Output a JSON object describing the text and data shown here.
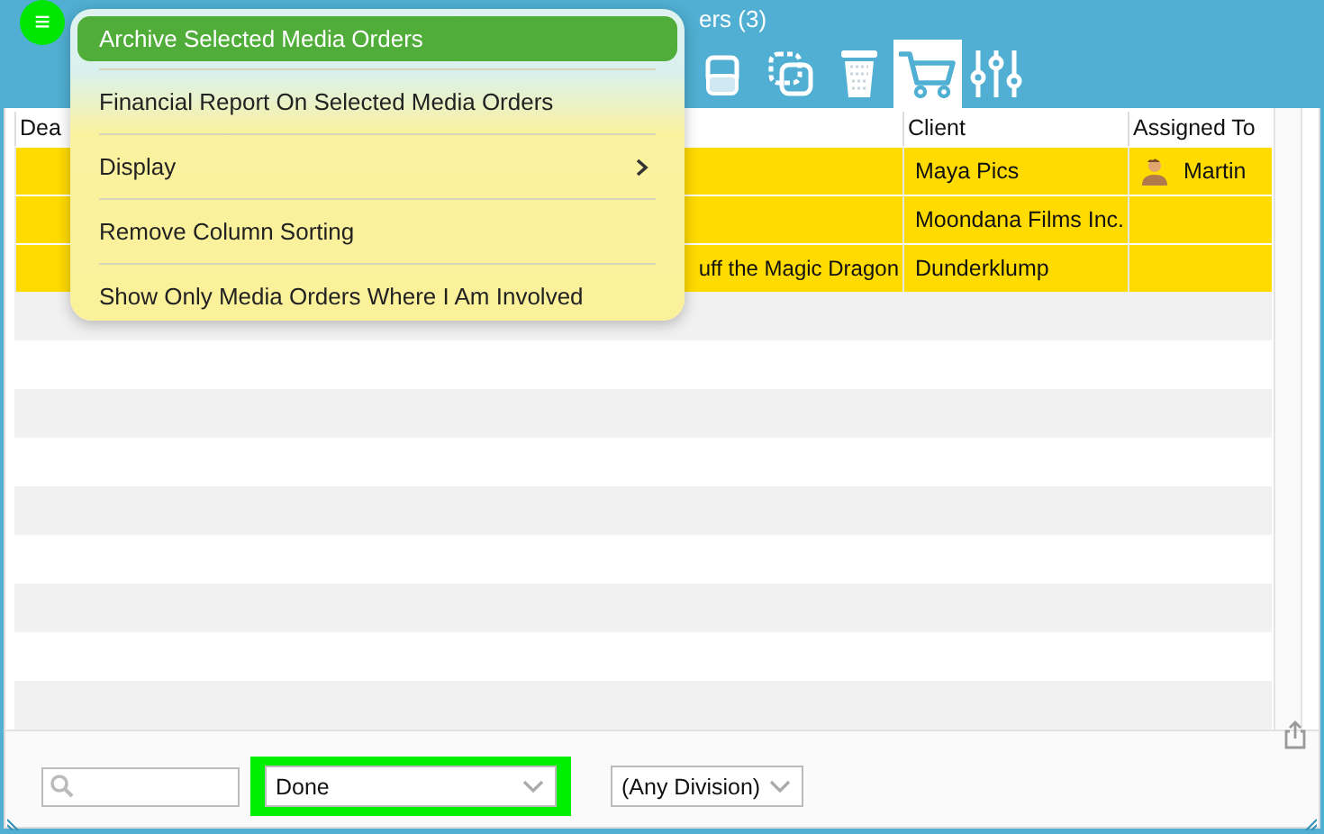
{
  "window": {
    "title": "ers (3)"
  },
  "menu_button": {
    "label": "≡"
  },
  "toolbar": [
    {
      "kind": "frames",
      "selected": false
    },
    {
      "kind": "copy",
      "selected": false
    },
    {
      "kind": "trash",
      "selected": false
    },
    {
      "kind": "cart",
      "selected": true
    },
    {
      "kind": "sliders",
      "selected": false
    }
  ],
  "table": {
    "columns": [
      "Dea",
      "Client",
      "Assigned To"
    ],
    "rows": [
      {
        "client": "Maya Pics",
        "assigned_to": "Martin",
        "highlighted": true
      },
      {
        "client": "Moondana Films Inc.",
        "highlighted": true
      },
      {
        "title": "uff the Magic Dragon",
        "client": "Dunderklump",
        "highlighted": true
      }
    ]
  },
  "menu": {
    "items": [
      {
        "label": "Archive Selected Media Orders",
        "selected": true,
        "submenu": false
      },
      {
        "label": "Financial Report On Selected Media Orders",
        "selected": false,
        "submenu": false
      },
      {
        "label": "Display",
        "selected": false,
        "submenu": true
      },
      {
        "label": "Remove Column Sorting",
        "selected": false,
        "submenu": false
      },
      {
        "label": "Show Only Media Orders Where I Am Involved",
        "selected": false,
        "submenu": false
      }
    ]
  },
  "filters": {
    "status": {
      "value": "Done",
      "highlighted": true
    },
    "division": {
      "value": "(Any Division)",
      "highlighted": false
    }
  }
}
